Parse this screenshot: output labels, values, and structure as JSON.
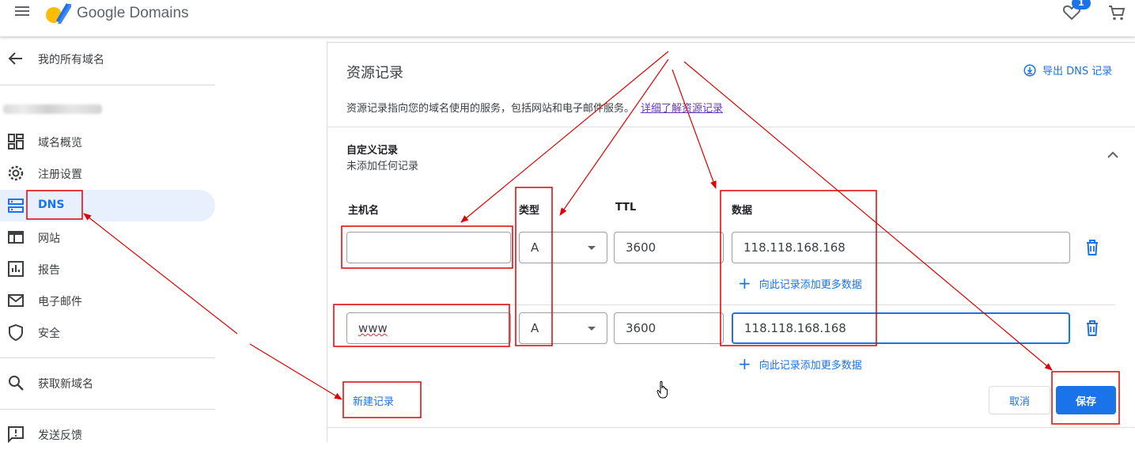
{
  "header": {
    "brand": "Google Domains",
    "favorites_badge": "1",
    "icons": [
      "menu-icon",
      "google-domains-logo",
      "heart-icon",
      "cart-icon"
    ],
    "colors": {
      "accent": "#1a73e8",
      "logo_yellow": "#fbbc04",
      "logo_blue": "#4285f4"
    }
  },
  "sidebar": {
    "back_label": "我的所有域名",
    "items": [
      {
        "label": "域名概览",
        "icon": "dashboard-icon"
      },
      {
        "label": "注册设置",
        "icon": "gear-icon"
      },
      {
        "label": "DNS",
        "icon": "dns-icon",
        "active": true
      },
      {
        "label": "网站",
        "icon": "web-icon"
      },
      {
        "label": "报告",
        "icon": "report-icon"
      },
      {
        "label": "电子邮件",
        "icon": "email-icon"
      },
      {
        "label": "安全",
        "icon": "shield-icon"
      }
    ],
    "get_domain_label": "获取新域名",
    "feedback_label": "发送反馈"
  },
  "resource_records": {
    "title": "资源记录",
    "export_label": "导出 DNS 记录",
    "description": "资源记录指向您的域名使用的服务，包括网站和电子邮件服务。",
    "learn_more": "详细了解资源记录",
    "custom": {
      "title": "自定义记录",
      "subtitle": "未添加任何记录"
    },
    "columns": {
      "host": "主机名",
      "type": "类型",
      "ttl": "TTL",
      "data": "数据"
    },
    "rows": [
      {
        "host": "",
        "type": "A",
        "ttl": "3600",
        "data": "118.118.168.168",
        "add_more": "向此记录添加更多数据"
      },
      {
        "host": "www",
        "type": "A",
        "ttl": "3600",
        "data": "118.118.168.168",
        "add_more": "向此记录添加更多数据"
      }
    ],
    "new_record": "新建记录",
    "cancel": "取消",
    "save": "保存"
  },
  "annotation_color": "#e00000"
}
